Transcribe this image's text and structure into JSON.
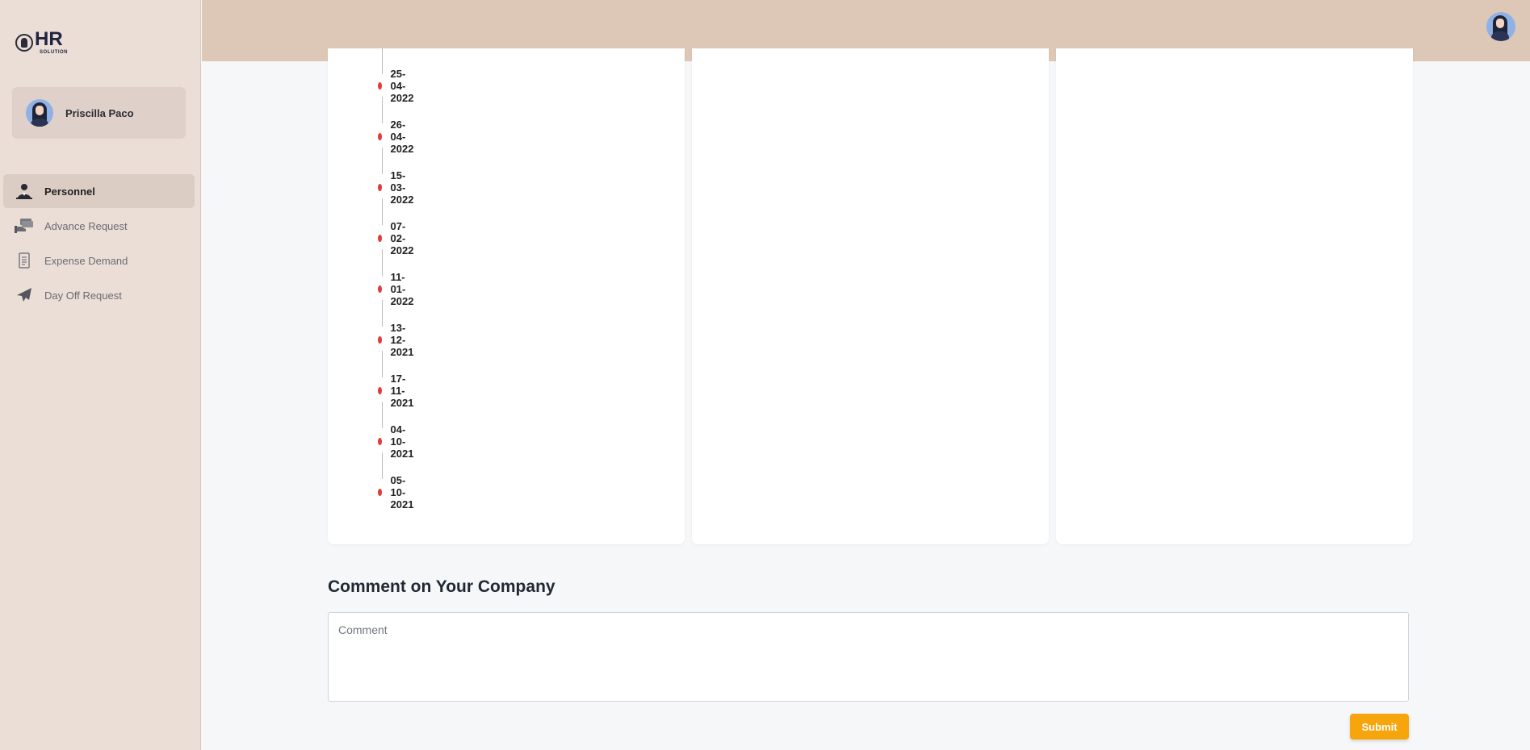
{
  "app": {
    "logo_main": "HR",
    "logo_sub": "SOLUTION"
  },
  "user": {
    "name": "Priscilla Paco",
    "avatar_icon": "avatar-woman-icon"
  },
  "sidebar": {
    "items": [
      {
        "label": "Personnel",
        "icon": "personnel-icon",
        "active": true
      },
      {
        "label": "Advance Request",
        "icon": "money-hand-icon",
        "active": false
      },
      {
        "label": "Expense Demand",
        "icon": "receipt-icon",
        "active": false
      },
      {
        "label": "Day Off Request",
        "icon": "airplane-icon",
        "active": false
      }
    ]
  },
  "timeline": {
    "dates": [
      "25-04-2022",
      "26-04-2022",
      "15-03-2022",
      "07-02-2022",
      "11-01-2022",
      "13-12-2021",
      "17-11-2021",
      "04-10-2021",
      "05-10-2021"
    ],
    "dot_color": "#e23d3d"
  },
  "comment": {
    "title": "Comment on Your Company",
    "placeholder": "Comment",
    "value": "",
    "submit_label": "Submit"
  },
  "colors": {
    "sidebar_bg": "#ebded6",
    "header_bg": "#ddc7b7",
    "accent": "#f7a50c"
  }
}
